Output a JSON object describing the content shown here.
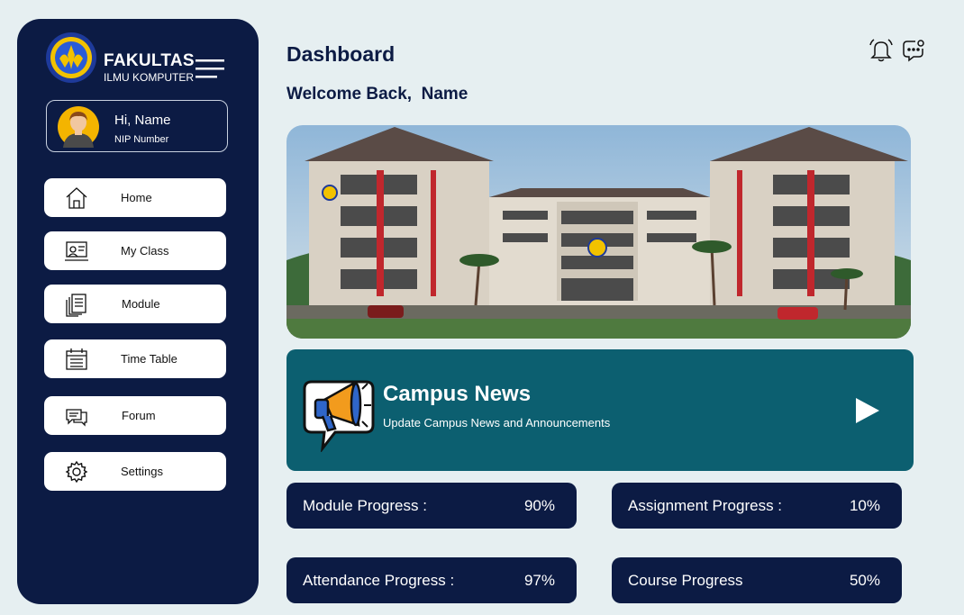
{
  "sidebar": {
    "brand_title": "FAKULTAS",
    "brand_subtitle": "ILMU KOMPUTER",
    "profile": {
      "greeting": "Hi, Name",
      "nip": "NIP Number"
    },
    "items": [
      {
        "label": "Home",
        "icon": "home-icon"
      },
      {
        "label": "My Class",
        "icon": "class-icon"
      },
      {
        "label": "Module",
        "icon": "module-icon"
      },
      {
        "label": "Time Table",
        "icon": "calendar-icon"
      },
      {
        "label": "Forum",
        "icon": "forum-icon"
      },
      {
        "label": "Settings",
        "icon": "gear-icon"
      }
    ]
  },
  "header": {
    "title": "Dashboard",
    "welcome": "Welcome Back,  Name"
  },
  "news": {
    "title": "Campus News",
    "subtitle": "Update Campus News and Announcements"
  },
  "progress": [
    {
      "label": "Module Progress :",
      "value": "90%"
    },
    {
      "label": "Assignment Progress :",
      "value": "10%"
    },
    {
      "label": "Attendance Progress :",
      "value": "97%"
    },
    {
      "label": "Course Progress",
      "value": "50%"
    }
  ],
  "colors": {
    "sidebar_bg": "#0c1b44",
    "page_bg": "#e6eff1",
    "news_bg": "#0c5f70",
    "card_bg": "#0c1b44"
  }
}
